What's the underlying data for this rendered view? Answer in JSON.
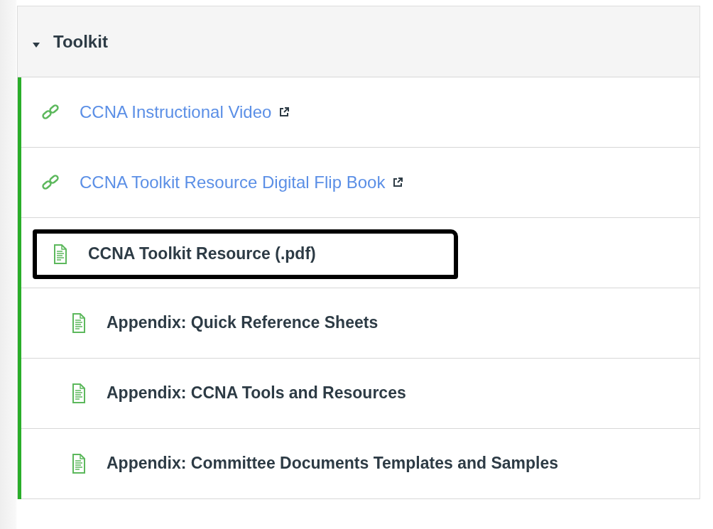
{
  "module": {
    "title": "Toolkit",
    "expanded": true,
    "items": [
      {
        "kind": "link",
        "title": "CCNA Instructional Video",
        "external": true,
        "highlighted": false
      },
      {
        "kind": "link",
        "title": "CCNA Toolkit Resource Digital Flip Book",
        "external": true,
        "highlighted": false
      },
      {
        "kind": "page",
        "title": "CCNA Toolkit Resource (.pdf)",
        "external": false,
        "highlighted": true,
        "children": [
          {
            "kind": "page",
            "title": "Appendix: Quick Reference Sheets",
            "external": false,
            "highlighted": false
          },
          {
            "kind": "page",
            "title": "Appendix: CCNA Tools and Resources",
            "external": false,
            "highlighted": false
          },
          {
            "kind": "page",
            "title": "Appendix: Committee Documents Templates and Samples",
            "external": false,
            "highlighted": false
          }
        ]
      }
    ]
  }
}
